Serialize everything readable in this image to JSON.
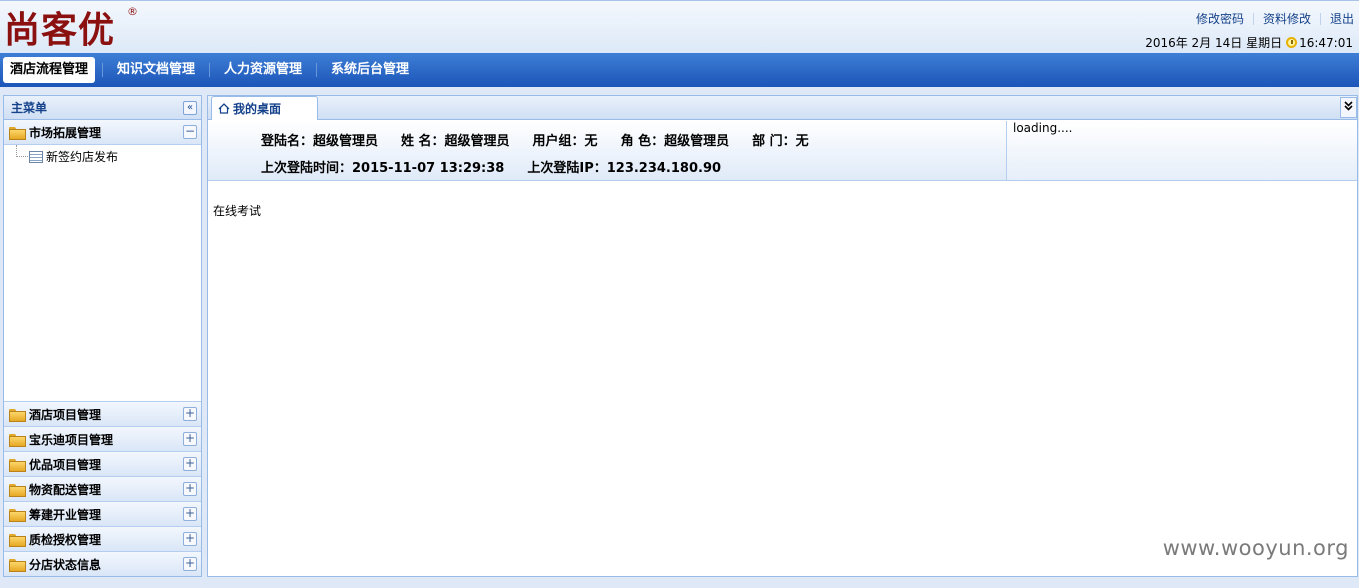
{
  "header": {
    "logo_text": "尚客优",
    "logo_mark": "®",
    "links": [
      "修改密码",
      "资料修改",
      "退出"
    ],
    "date": "2016年 2月 14日 星期日",
    "time": "16:47:01"
  },
  "nav": {
    "items": [
      "酒店流程管理",
      "知识文档管理",
      "人力资源管理",
      "系统后台管理"
    ],
    "active_index": 0
  },
  "sidebar": {
    "title": "主菜单",
    "collapse_glyph": "«",
    "expanded_panel": {
      "label": "市场拓展管理",
      "toggle": "−",
      "items": [
        "新签约店发布"
      ]
    },
    "panels": [
      {
        "label": "酒店项目管理",
        "toggle": "+"
      },
      {
        "label": "宝乐迪项目管理",
        "toggle": "+"
      },
      {
        "label": "优品项目管理",
        "toggle": "+"
      },
      {
        "label": "物资配送管理",
        "toggle": "+"
      },
      {
        "label": "筹建开业管理",
        "toggle": "+"
      },
      {
        "label": "质检授权管理",
        "toggle": "+"
      },
      {
        "label": "分店状态信息",
        "toggle": "+"
      }
    ]
  },
  "main": {
    "tab_label": "我的桌面",
    "tab_menu_glyph": "»",
    "info": {
      "login_name": "登陆名：超级管理员",
      "name": "姓 名：超级管理员",
      "user_group": "用户组：无",
      "role": "角 色：超级管理员",
      "department": "部 门：无",
      "last_login_time": "上次登陆时间：2015-11-07 13:29:38",
      "last_login_ip": "上次登陆IP：123.234.180.90"
    },
    "loading_text": "loading....",
    "content_text": "在线考试"
  },
  "watermark": "www.wooyun.org",
  "colors": {
    "nav_bg": "#1c55b8",
    "logo": "#8b1010",
    "link": "#15428b",
    "border": "#99bbe8"
  },
  "icons": {
    "home": "home-icon",
    "folder": "folder-icon",
    "list": "list-icon",
    "clock": "clock-icon"
  }
}
